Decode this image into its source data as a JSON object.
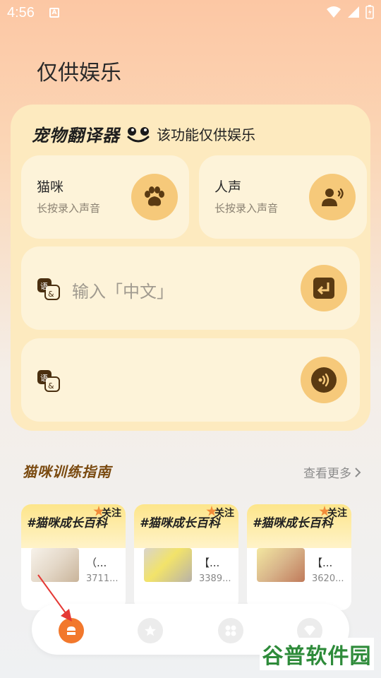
{
  "status_bar": {
    "time": "4:56",
    "a_badge": "A"
  },
  "page_title": "仅供娱乐",
  "translator": {
    "brand": "宠物翻译器",
    "note": "该功能仅供娱乐",
    "cat": {
      "title": "猫咪",
      "subtitle": "长按录入声音",
      "icon": "paw-icon"
    },
    "human": {
      "title": "人声",
      "subtitle": "长按录入声音",
      "icon": "person-voice-icon"
    },
    "input": {
      "placeholder": "输入「中文」",
      "icon": "enter-icon"
    },
    "output": {
      "text": "",
      "icon": "speaker-icon"
    }
  },
  "guide": {
    "title": "猫咪训练指南",
    "more": "查看更多",
    "cards": [
      {
        "tag": "#猫咪成长百科",
        "follow": "关注",
        "text": "（...",
        "count": "3711..."
      },
      {
        "tag": "#猫咪成长百科",
        "follow": "关注",
        "text": "【...",
        "count": "3389..."
      },
      {
        "tag": "#猫咪成长百科",
        "follow": "关注",
        "text": "【...",
        "count": "3620..."
      }
    ]
  },
  "nav": [
    "home-icon",
    "star-icon",
    "grid-icon",
    "diamond-icon"
  ],
  "watermark": "谷普软件园",
  "colors": {
    "accent": "#f2782c",
    "card": "#fdeabf",
    "button": "#f6c97a",
    "icon_dark": "#5a3a12"
  }
}
